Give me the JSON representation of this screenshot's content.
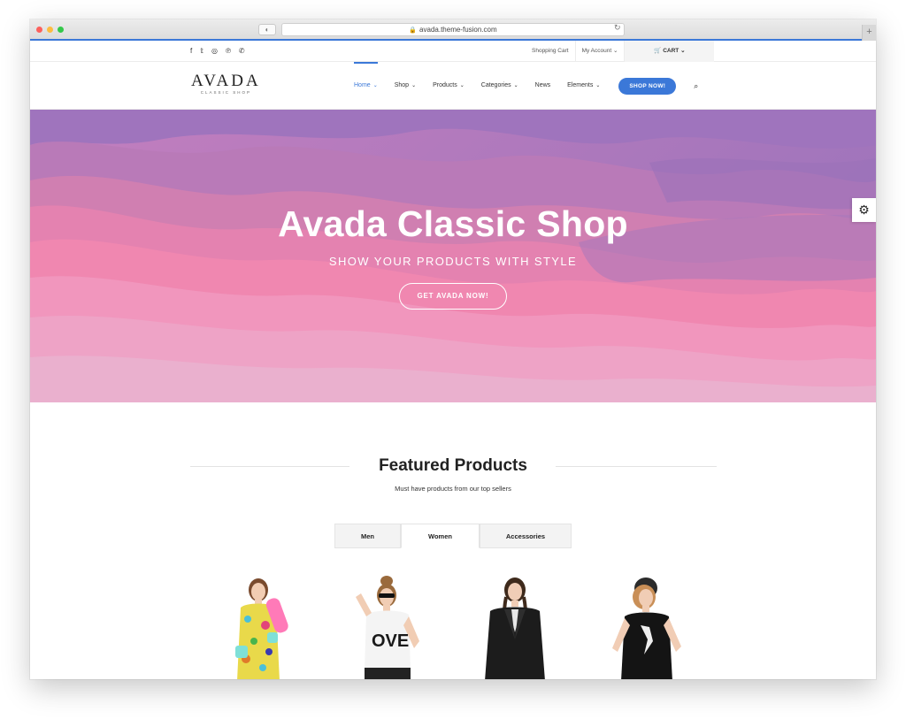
{
  "browser": {
    "url": "avada.theme-fusion.com",
    "plus": "+"
  },
  "topbar": {
    "social_icons": [
      "facebook-icon",
      "twitter-icon",
      "instagram-icon",
      "pinterest-icon",
      "whatsapp-icon"
    ],
    "social_glyphs": [
      "f",
      "𝕥",
      "◎",
      "℗",
      "✆"
    ],
    "shopping_cart": "Shopping Cart",
    "my_account": "My Account",
    "cart": "CART"
  },
  "header": {
    "logo_main": "AVADA",
    "logo_sub": "CLASSIC SHOP",
    "nav": [
      {
        "label": "Home",
        "dropdown": true,
        "active": true
      },
      {
        "label": "Shop",
        "dropdown": true
      },
      {
        "label": "Products",
        "dropdown": true
      },
      {
        "label": "Categories",
        "dropdown": true
      },
      {
        "label": "News",
        "dropdown": false
      },
      {
        "label": "Elements",
        "dropdown": true
      }
    ],
    "shop_now": "SHOP NOW!"
  },
  "hero": {
    "title": "Avada Classic Shop",
    "subtitle": "SHOW YOUR PRODUCTS WITH STYLE",
    "button": "GET AVADA NOW!"
  },
  "featured": {
    "title": "Featured Products",
    "subtitle": "Must have products from our top sellers",
    "tabs": [
      {
        "label": "Men",
        "active": false
      },
      {
        "label": "Women",
        "active": true
      },
      {
        "label": "Accessories",
        "active": false
      }
    ],
    "shirt_text": "OVE"
  },
  "colors": {
    "accent": "#3b78d8",
    "hero_pink": "#f283b0",
    "hero_purple": "#9a72b8"
  }
}
